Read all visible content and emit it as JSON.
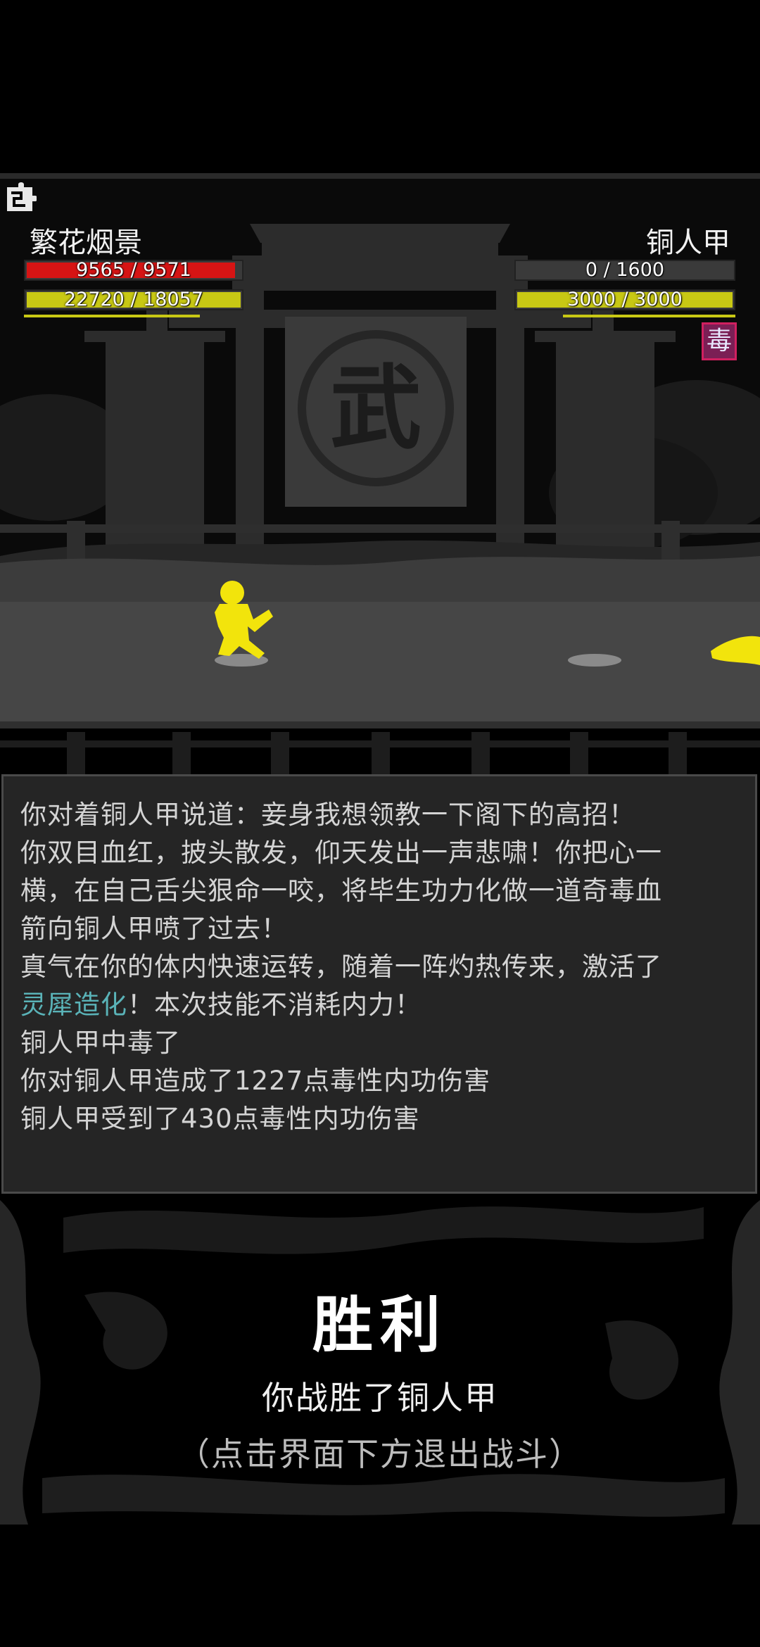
{
  "player": {
    "name": "繁花烟景",
    "hp_text": "9565 / 9571",
    "hp_fraction": 0.999,
    "mp_text": "22720 / 18057",
    "mp_fraction": 1.0
  },
  "enemy": {
    "name": "铜人甲",
    "hp_text": "0 / 1600",
    "hp_fraction": 0.0,
    "mp_text": "3000 / 3000",
    "mp_fraction": 1.0,
    "status_badge": "毒"
  },
  "banner_glyph": "武",
  "icons": {
    "menu": "puzzle-menu-icon"
  },
  "colors": {
    "hp": "#d61414",
    "mp": "#c8c814",
    "character": "#f2e40c",
    "highlight": "#5ab3b8"
  },
  "log": {
    "lines": [
      "你对着铜人甲说道：妾身我想领教一下阁下的高招！",
      "你双目血红，披头散发，仰天发出一声悲啸！你把心一",
      "横，在自己舌尖狠命一咬，将毕生功力化做一道奇毒血",
      "箭向铜人甲喷了过去！",
      "真气在你的体内快速运转，随着一阵灼热传来，激活了",
      "！本次技能不消耗内力！",
      "铜人甲中毒了",
      "你对铜人甲造成了1227点毒性内功伤害",
      "铜人甲受到了430点毒性内功伤害"
    ],
    "skill_name": "灵犀造化"
  },
  "result": {
    "title": "胜利",
    "subtitle": "你战胜了铜人甲",
    "hint": "（点击界面下方退出战斗）"
  }
}
